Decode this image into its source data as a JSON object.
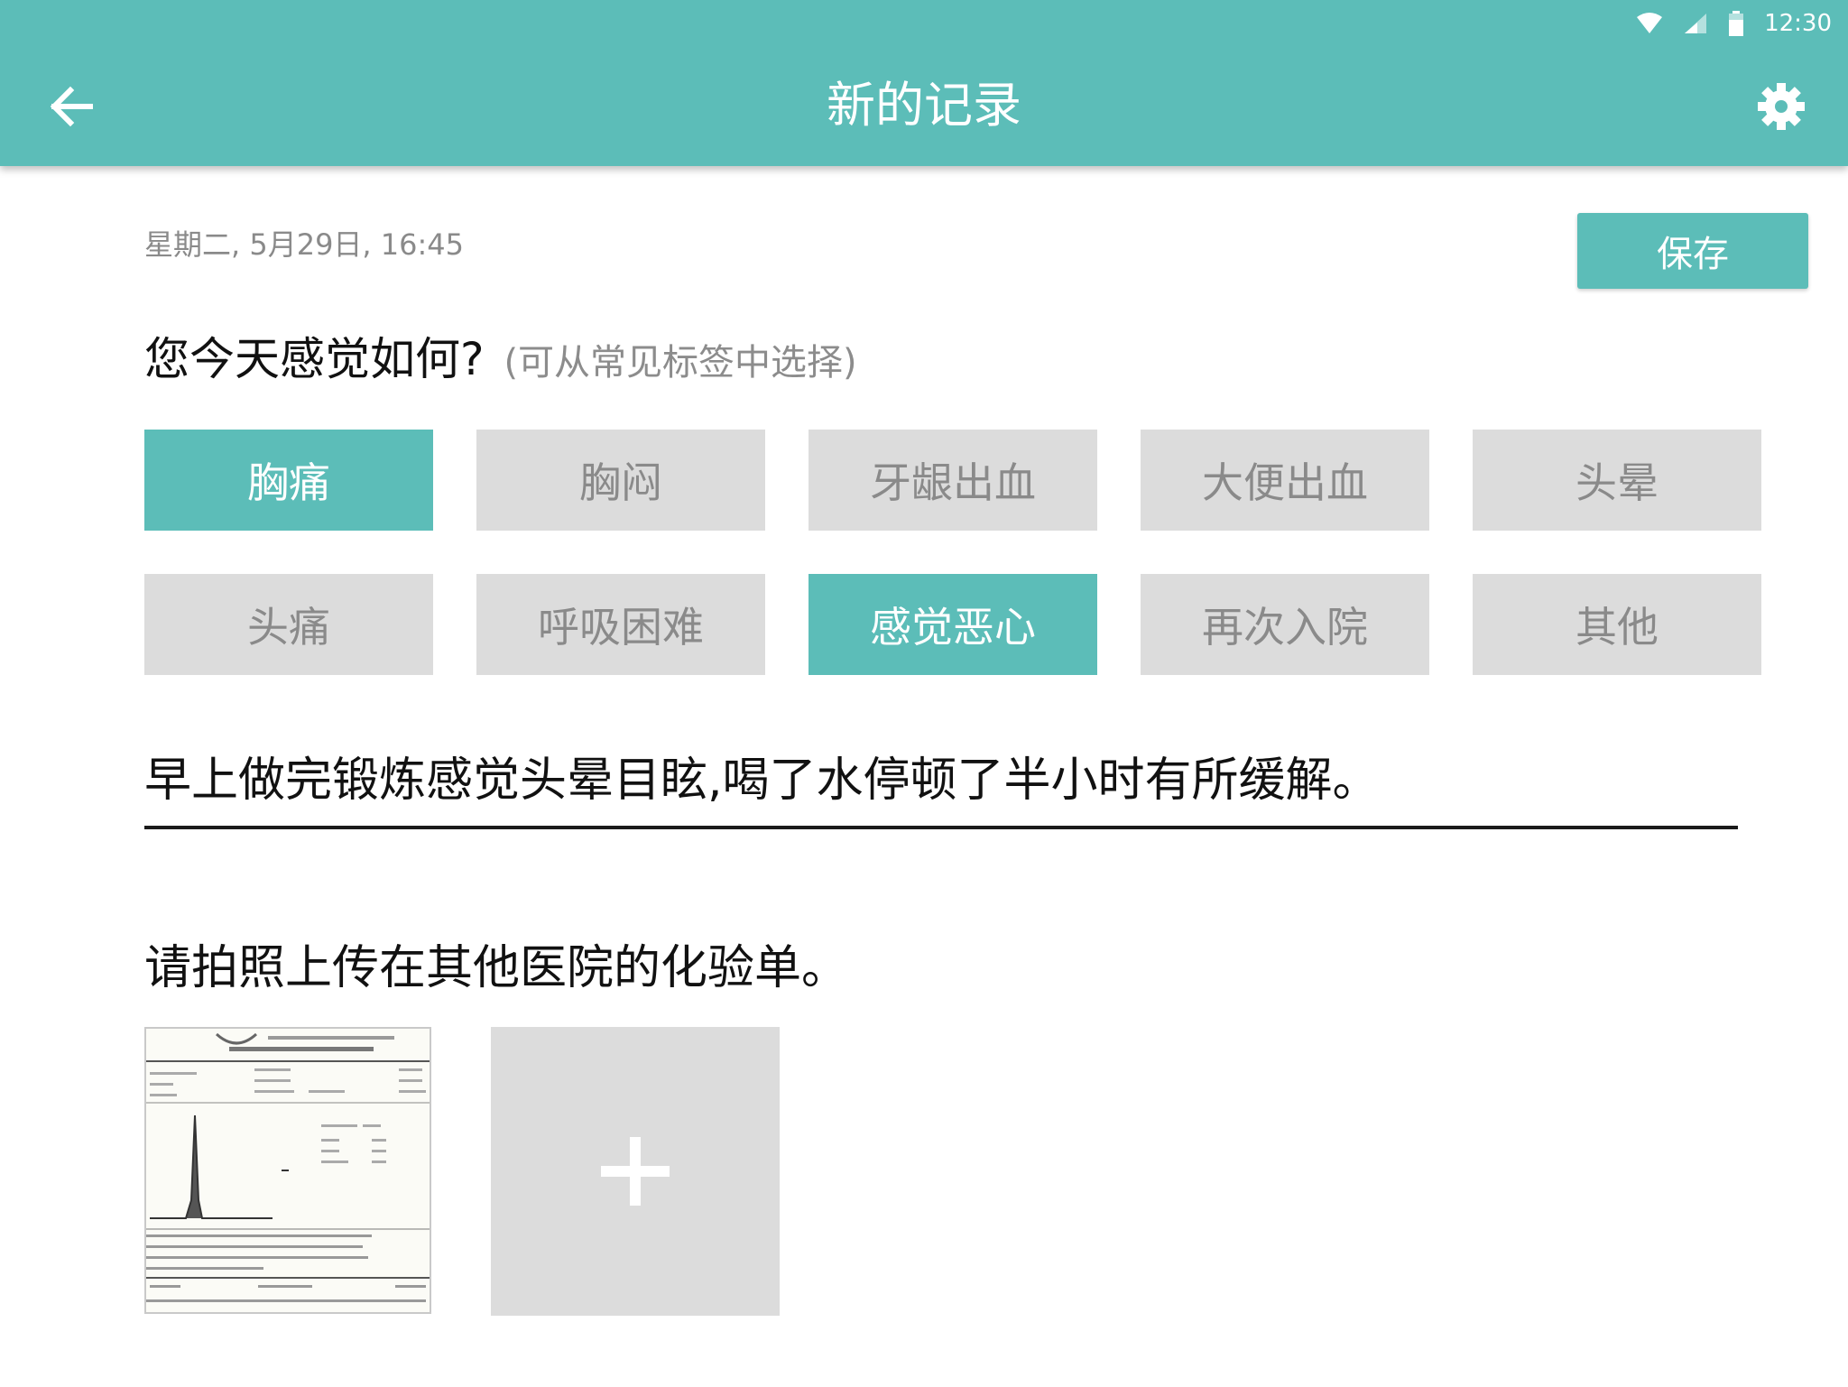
{
  "status_bar": {
    "time": "12:30"
  },
  "app_bar": {
    "title": "新的记录"
  },
  "record": {
    "date": "星期二, 5月29日, 16:45",
    "save_label": "保存"
  },
  "question": {
    "text": "您今天感觉如何?",
    "hint": "(可从常见标签中选择)"
  },
  "tags": [
    {
      "label": "胸痛",
      "selected": true
    },
    {
      "label": "胸闷",
      "selected": false
    },
    {
      "label": "牙龈出血",
      "selected": false
    },
    {
      "label": "大便出血",
      "selected": false
    },
    {
      "label": "头晕",
      "selected": false
    },
    {
      "label": "头痛",
      "selected": false
    },
    {
      "label": "呼吸困难",
      "selected": false
    },
    {
      "label": "感觉恶心",
      "selected": true
    },
    {
      "label": "再次入院",
      "selected": false
    },
    {
      "label": "其他",
      "selected": false
    }
  ],
  "note": {
    "value": "早上做完锻炼感觉头晕目眩,喝了水停顿了半小时有所缓解。"
  },
  "upload": {
    "label": "请拍照上传在其他医院的化验单。"
  },
  "colors": {
    "accent": "#5cbdb8",
    "tag_bg": "#dcdcdc",
    "tag_text": "#8a8a8a"
  },
  "icons": {
    "back": "arrow-left-icon",
    "settings": "gear-icon",
    "wifi": "wifi-icon",
    "signal": "signal-icon",
    "battery": "battery-icon",
    "add": "plus-icon"
  }
}
